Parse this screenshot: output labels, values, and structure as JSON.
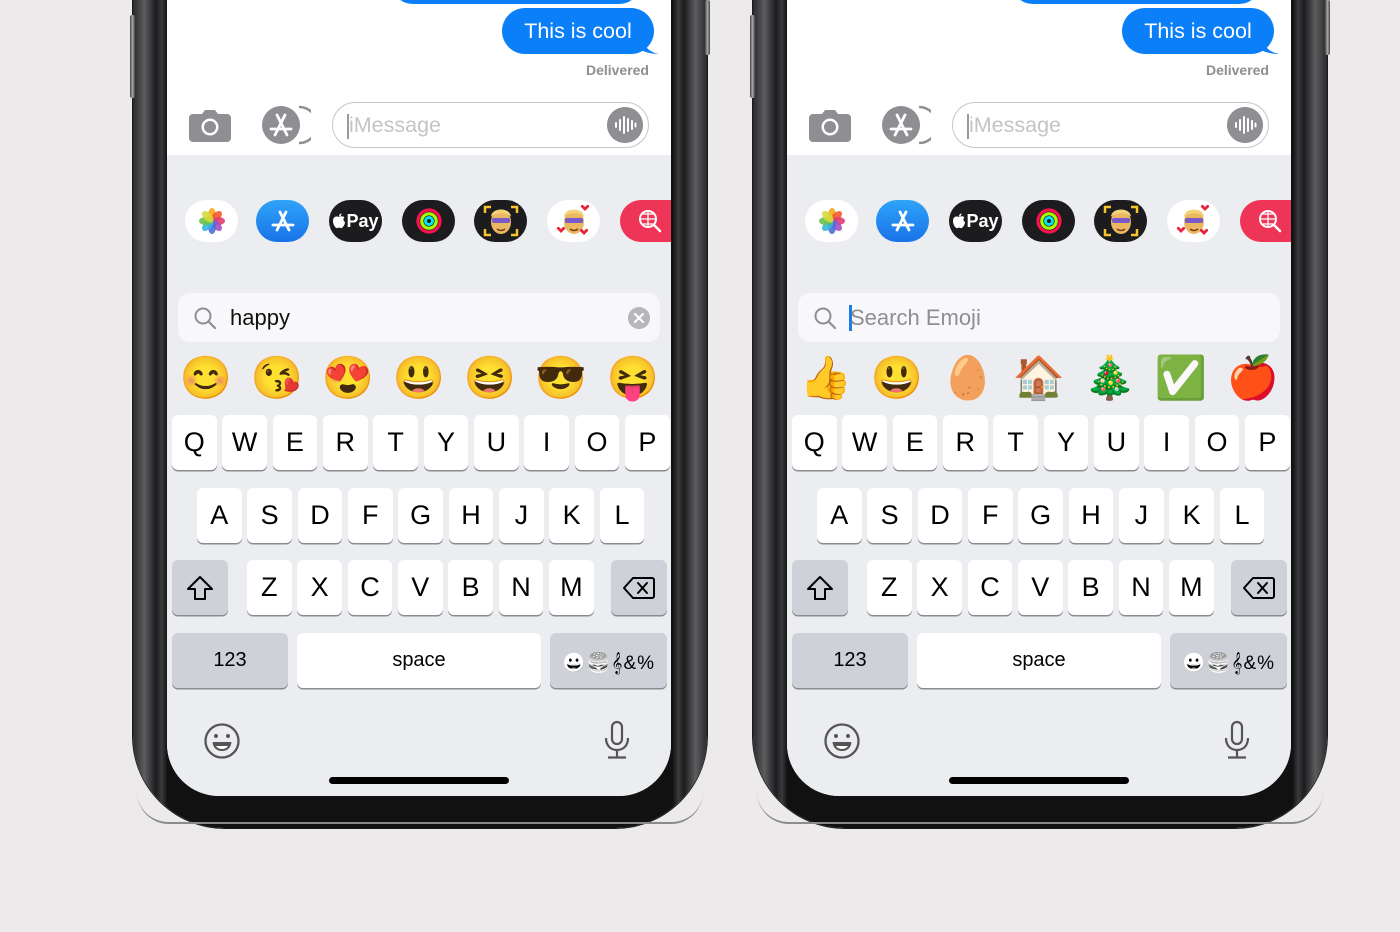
{
  "phones": [
    {
      "id": "left",
      "message": {
        "text": "This is cool",
        "status": "Delivered"
      },
      "input": {
        "placeholder": "iMessage"
      },
      "app_strip": [
        {
          "name": "Photos",
          "icon": "photos-icon"
        },
        {
          "name": "App Store",
          "icon": "app-store-icon"
        },
        {
          "name": "Apple Pay",
          "icon": "apple-pay-icon",
          "label": "Pay"
        },
        {
          "name": "Activity",
          "icon": "activity-rings-icon"
        },
        {
          "name": "Memoji",
          "icon": "memoji-icon",
          "glyph": "👩‍🦲"
        },
        {
          "name": "Memoji Stickers",
          "icon": "memoji-stickers-icon",
          "glyph": "🥰"
        },
        {
          "name": "Images Search",
          "icon": "globe-search-icon"
        }
      ],
      "search": {
        "value": "happy",
        "placeholder": "Search Emoji",
        "has_clear": true
      },
      "emoji_results": [
        "😊",
        "😘",
        "😍",
        "😃",
        "😆",
        "😎",
        "😝"
      ]
    },
    {
      "id": "right",
      "message": {
        "text": "This is cool",
        "status": "Delivered"
      },
      "input": {
        "placeholder": "iMessage"
      },
      "app_strip": [
        {
          "name": "Photos",
          "icon": "photos-icon"
        },
        {
          "name": "App Store",
          "icon": "app-store-icon"
        },
        {
          "name": "Apple Pay",
          "icon": "apple-pay-icon",
          "label": "Pay"
        },
        {
          "name": "Activity",
          "icon": "activity-rings-icon"
        },
        {
          "name": "Memoji",
          "icon": "memoji-icon",
          "glyph": "👩‍🦲"
        },
        {
          "name": "Memoji Stickers",
          "icon": "memoji-stickers-icon",
          "glyph": "🥰"
        },
        {
          "name": "Images Search",
          "icon": "globe-search-icon"
        }
      ],
      "search": {
        "value": "",
        "placeholder": "Search Emoji",
        "has_clear": false
      },
      "emoji_results": [
        "👍",
        "😃",
        "🥚",
        "🏠",
        "🎄",
        "✅",
        "🍎"
      ]
    }
  ],
  "keyboard": {
    "row1": [
      "Q",
      "W",
      "E",
      "R",
      "T",
      "Y",
      "U",
      "I",
      "O",
      "P"
    ],
    "row2": [
      "A",
      "S",
      "D",
      "F",
      "G",
      "H",
      "J",
      "K",
      "L"
    ],
    "row3": [
      "Z",
      "X",
      "C",
      "V",
      "B",
      "N",
      "M"
    ],
    "shift_icon": "shift-icon",
    "delete_icon": "delete-icon",
    "numbers_label": "123",
    "space_label": "space",
    "emoji_key_label": "😀🍔𝄞&%"
  },
  "colors": {
    "bubble": "#0b7ff8",
    "keyboard_bg": "#ecedf0",
    "dark_key": "#ced1d8",
    "search_caret": "#1a7ee8",
    "page_bg": "#eceaeb"
  }
}
